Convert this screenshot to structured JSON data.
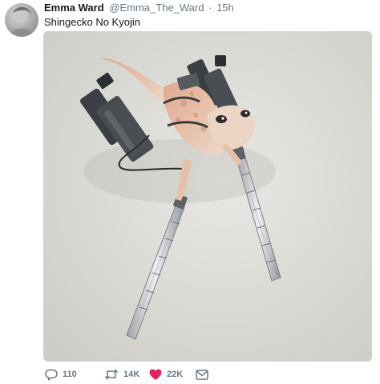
{
  "tweet": {
    "author_name": "Emma Ward",
    "author_handle": "@Emma_The_Ward",
    "separator": "·",
    "time": "15h",
    "text": "Shingecko No Kyojin"
  },
  "actions": {
    "reply_count": "110",
    "retweet_count": "14K",
    "like_count": "22K",
    "like_color": "#e0245e"
  },
  "icons": {
    "reply": "reply-icon",
    "retweet": "retweet-icon",
    "like": "heart-icon",
    "dm": "envelope-icon"
  },
  "colors": {
    "name": "#14171a",
    "muted": "#657786",
    "like": "#e0245e"
  }
}
